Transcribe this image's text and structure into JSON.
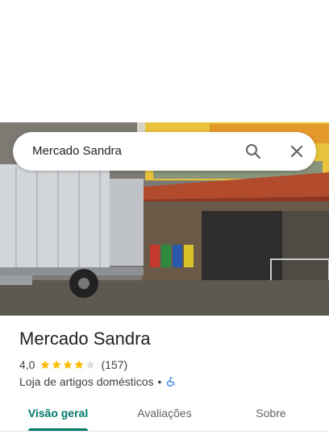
{
  "search": {
    "query": "Mercado Sandra"
  },
  "icons": {
    "search": "search-icon",
    "close": "close-icon",
    "accessible": "wheelchair-accessible-icon",
    "star": "star-icon"
  },
  "place": {
    "name": "Mercado Sandra",
    "rating": "4,0",
    "rating_stars": 4,
    "rating_stars_max": 5,
    "review_count": "(157)",
    "category": "Loja de artigos domésticos",
    "separator": "•"
  },
  "tabs": [
    {
      "label": "Visão geral",
      "active": true
    },
    {
      "label": "Avaliações",
      "active": false
    },
    {
      "label": "Sobre",
      "active": false
    }
  ],
  "colors": {
    "accent": "#00796b",
    "star_filled": "#fbbc04",
    "star_empty": "#dadce0",
    "accessible_icon": "#1a73e8"
  }
}
